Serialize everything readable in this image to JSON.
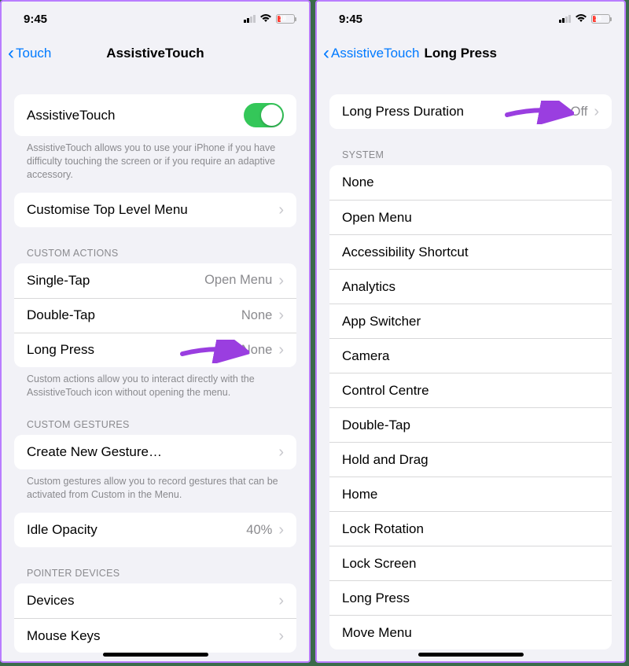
{
  "status": {
    "time": "9:45",
    "battery": "18"
  },
  "left": {
    "back": "Touch",
    "title": "AssistiveTouch",
    "rowA": "AssistiveTouch",
    "footerA": "AssistiveTouch allows you to use your iPhone if you have difficulty touching the screen or if you require an adaptive accessory.",
    "rowB": "Customise Top Level Menu",
    "sectionC": "CUSTOM ACTIONS",
    "single": {
      "label": "Single-Tap",
      "value": "Open Menu"
    },
    "double": {
      "label": "Double-Tap",
      "value": "None"
    },
    "long": {
      "label": "Long Press",
      "value": "None"
    },
    "footerC": "Custom actions allow you to interact directly with the AssistiveTouch icon without opening the menu.",
    "sectionD": "CUSTOM GESTURES",
    "create": "Create New Gesture…",
    "footerD": "Custom gestures allow you to record gestures that can be activated from Custom in the Menu.",
    "idle": {
      "label": "Idle Opacity",
      "value": "40%"
    },
    "sectionE": "POINTER DEVICES",
    "devices": "Devices",
    "mouse": "Mouse Keys"
  },
  "right": {
    "back": "AssistiveTouch",
    "title": "Long Press",
    "duration": {
      "label": "Long Press Duration",
      "value": "Off"
    },
    "sectionSys": "SYSTEM",
    "items": [
      "None",
      "Open Menu",
      "Accessibility Shortcut",
      "Analytics",
      "App Switcher",
      "Camera",
      "Control Centre",
      "Double-Tap",
      "Hold and Drag",
      "Home",
      "Lock Rotation",
      "Lock Screen",
      "Long Press",
      "Move Menu"
    ]
  }
}
